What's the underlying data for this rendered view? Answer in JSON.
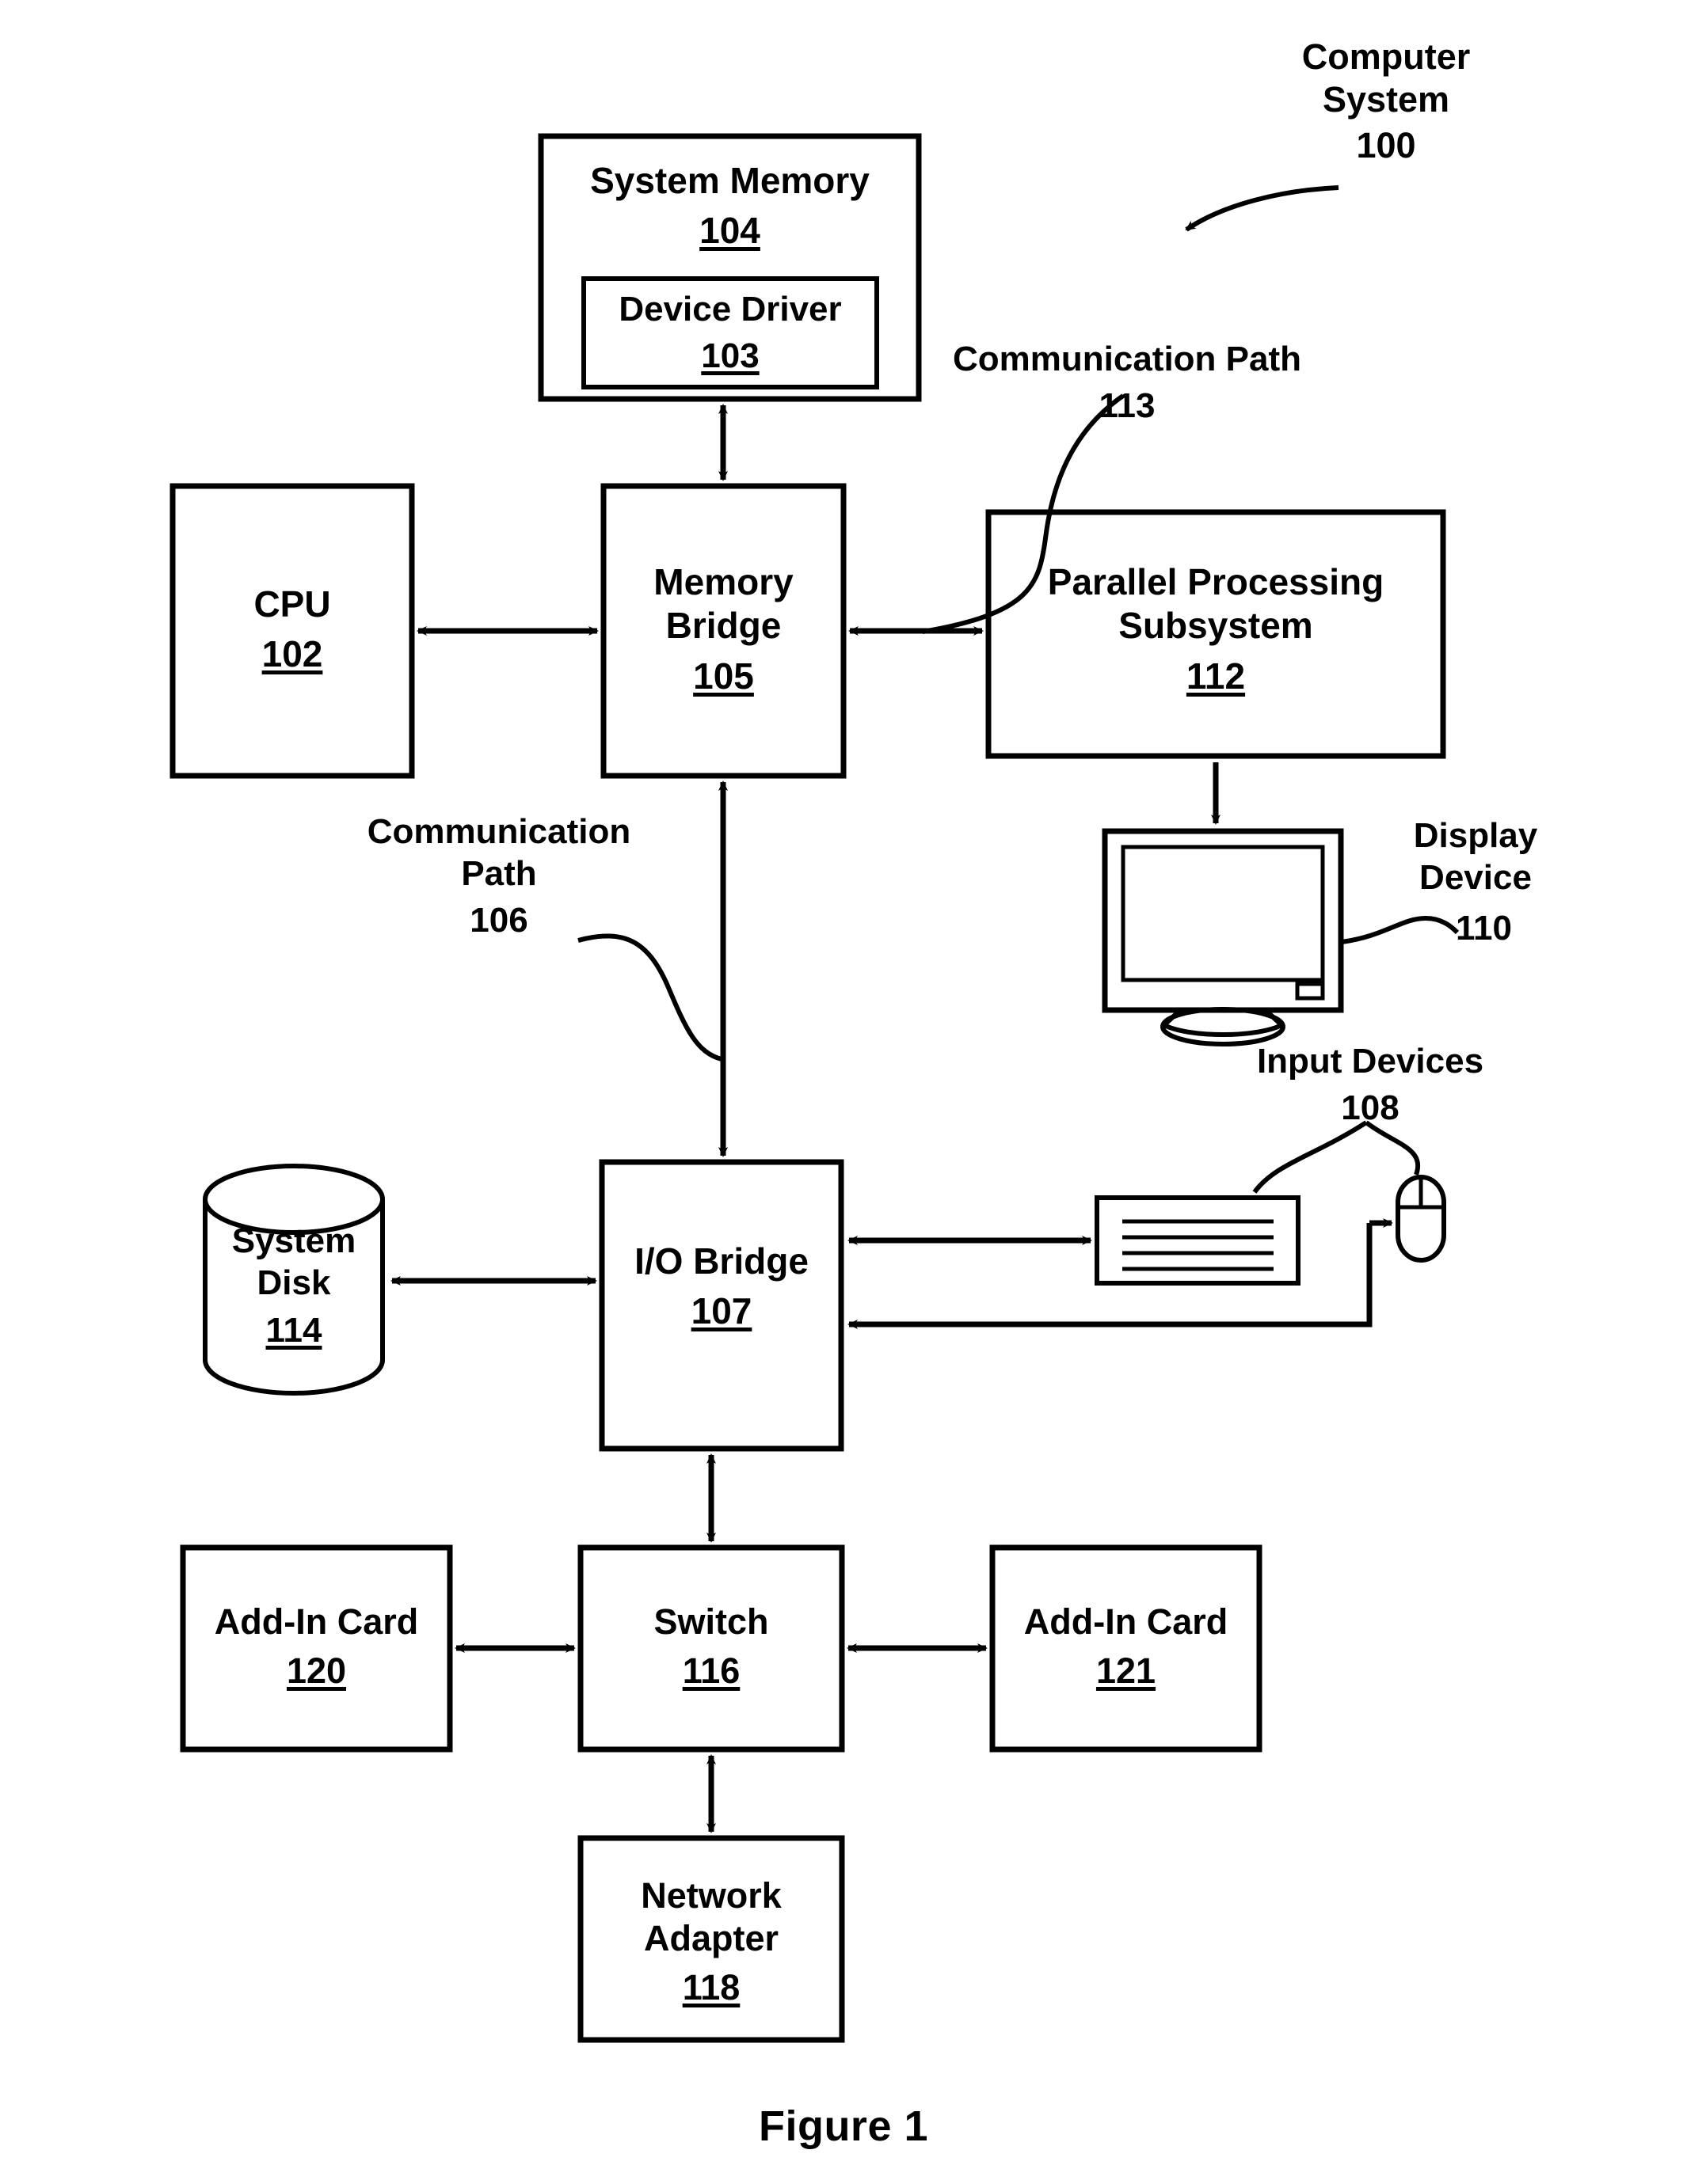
{
  "figure": {
    "caption": "Figure 1",
    "title_callout": {
      "line1": "Computer",
      "line2": "System",
      "number": "100"
    }
  },
  "blocks": [
    {
      "id": "system-memory",
      "title": "System Memory",
      "number": "104"
    },
    {
      "id": "device-driver",
      "title": "Device Driver",
      "number": "103"
    },
    {
      "id": "cpu",
      "title": "CPU",
      "number": "102"
    },
    {
      "id": "memory-bridge",
      "title_line1": "Memory",
      "title_line2": "Bridge",
      "number": "105"
    },
    {
      "id": "parallel-processing-subsystem",
      "title_line1": "Parallel Processing",
      "title_line2": "Subsystem",
      "number": "112"
    },
    {
      "id": "io-bridge",
      "title": "I/O Bridge",
      "number": "107"
    },
    {
      "id": "system-disk",
      "title_line1": "System",
      "title_line2": "Disk",
      "number": "114"
    },
    {
      "id": "add-in-card-120",
      "title": "Add-In Card",
      "number": "120"
    },
    {
      "id": "switch",
      "title": "Switch",
      "number": "116"
    },
    {
      "id": "add-in-card-121",
      "title": "Add-In Card",
      "number": "121"
    },
    {
      "id": "network-adapter",
      "title_line1": "Network",
      "title_line2": "Adapter",
      "number": "118"
    }
  ],
  "callouts": {
    "comm_path_113": {
      "label": "Communication Path",
      "number": "113"
    },
    "comm_path_106": {
      "label_line1": "Communication",
      "label_line2": "Path",
      "number": "106"
    },
    "display_device": {
      "label_line1": "Display",
      "label_line2": "Device",
      "number": "110"
    },
    "input_devices": {
      "label": "Input Devices",
      "number": "108"
    }
  },
  "colors": {
    "stroke": "#000000",
    "background": "#ffffff"
  }
}
